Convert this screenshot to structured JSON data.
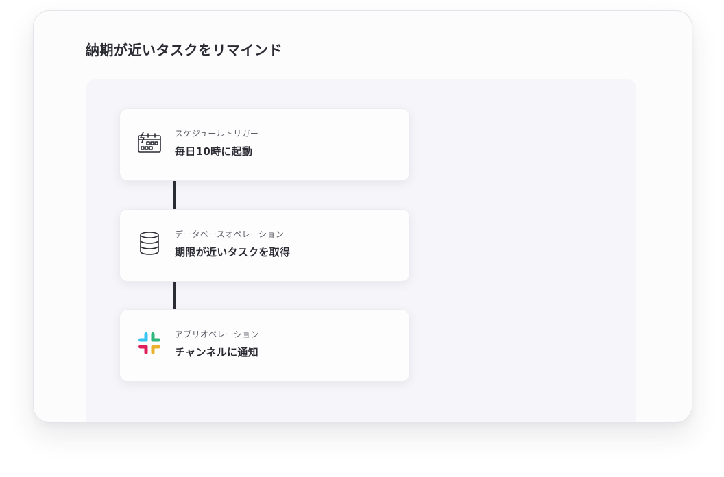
{
  "workflow": {
    "title": "納期が近いタスクをリマインド",
    "steps": [
      {
        "kind": "スケジュールトリガー",
        "action": "毎日10時に起動",
        "icon": "calendar-clock-icon"
      },
      {
        "kind": "データベースオペレーション",
        "action": "期限が近いタスクを取得",
        "icon": "database-icon"
      },
      {
        "kind": "アプリオペレーション",
        "action": "チャンネルに通知",
        "icon": "slack-icon"
      }
    ]
  },
  "colors": {
    "line": "#2b2b33",
    "canvas": "#f6f6fa",
    "slack_blue": "#36c5f0",
    "slack_green": "#2eb67d",
    "slack_yellow": "#ecb22e",
    "slack_red": "#e01e5a"
  }
}
